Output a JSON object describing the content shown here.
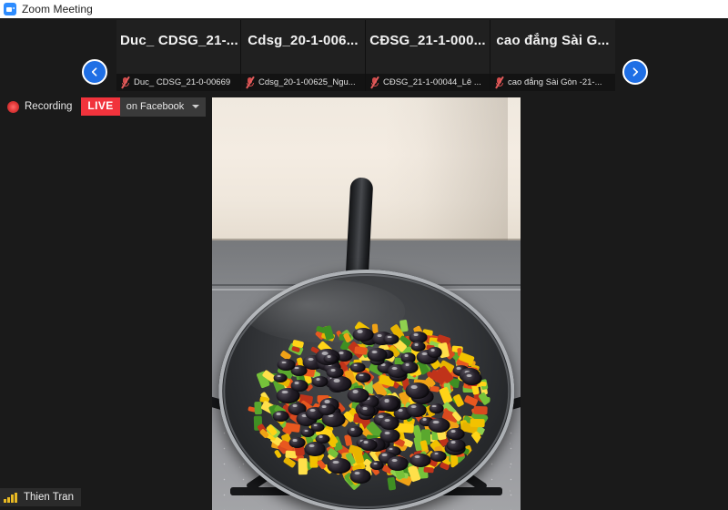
{
  "window": {
    "title": "Zoom Meeting",
    "app_icon": "zoom-camera-icon"
  },
  "filmstrip": {
    "prev_icon": "chevron-left-icon",
    "next_icon": "chevron-right-icon",
    "thumbnails": [
      {
        "display_title": "Duc_ CDSG_21-...",
        "name": "Duc_ CDSG_21-0-00669",
        "mic_icon": "microphone-muted-icon",
        "muted": true
      },
      {
        "display_title": "Cdsg_20-1-006...",
        "name": "Cdsg_20-1-00625_Ngu...",
        "mic_icon": "microphone-muted-icon",
        "muted": true
      },
      {
        "display_title": "CĐSG_21-1-000...",
        "name": "CĐSG_21-1-00044_Lê ...",
        "mic_icon": "microphone-muted-icon",
        "muted": true
      },
      {
        "display_title": "cao đẳng Sài G...",
        "name": "cao đẳng Sài Gòn -21-...",
        "mic_icon": "microphone-muted-icon",
        "muted": true
      }
    ]
  },
  "status": {
    "recording_icon": "recording-dot-icon",
    "recording_label": "Recording",
    "live_label": "LIVE",
    "live_color": "#f1333c",
    "stream_target": "on Facebook",
    "dropdown_icon": "caret-down-icon"
  },
  "self_view": {
    "signal_icon": "signal-bars-icon",
    "name": "Thien Tran",
    "signal_color": "#e8b923"
  },
  "video": {
    "description": "Black frying pan on a gas stove with diced yellow, red and green bell peppers and black olives, blue flame below"
  }
}
